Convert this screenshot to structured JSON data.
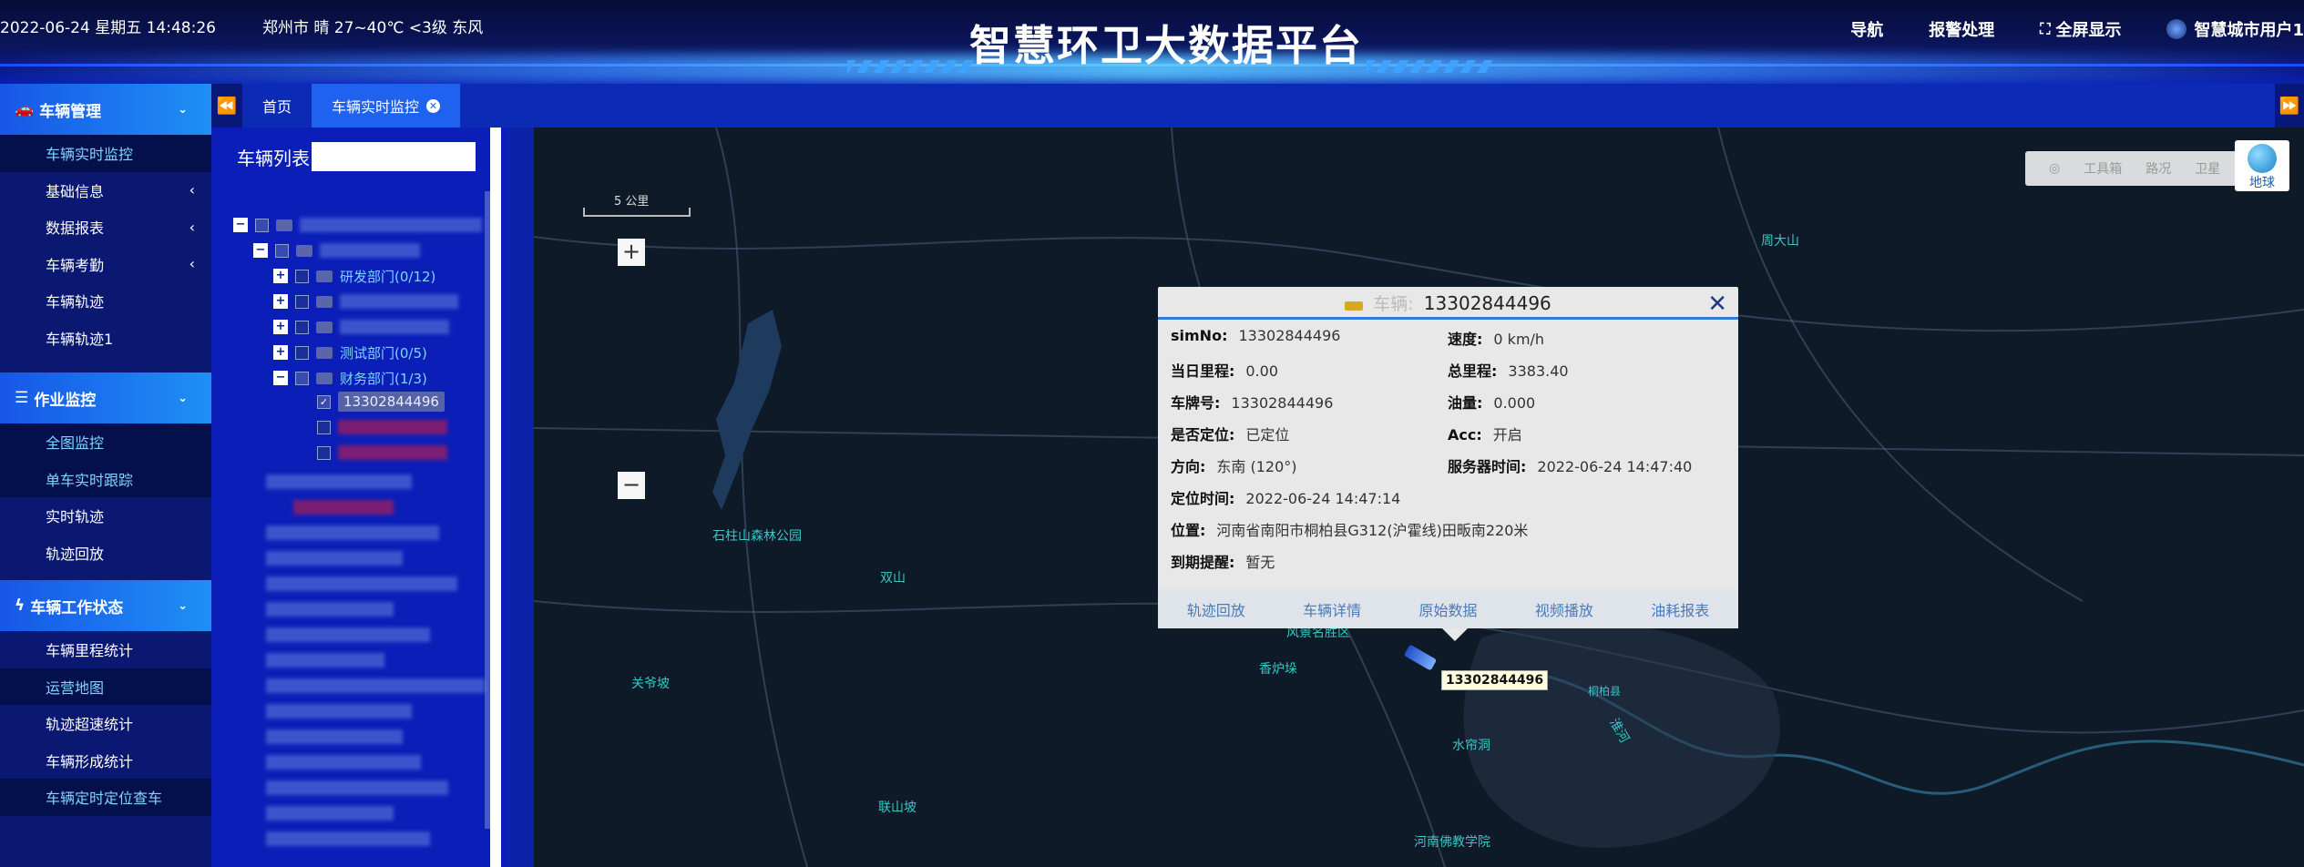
{
  "header": {
    "datetime": "2022-06-24 星期五 14:48:26",
    "weather": "郑州市 晴 27~40℃ <3级 东风",
    "title": "智慧环卫大数据平台",
    "nav": {
      "navigate": "导航",
      "alarm": "报警处理",
      "fullscreen": "全屏显示",
      "user": "智慧城市用户1"
    }
  },
  "sidebar": {
    "sections": [
      {
        "label": "车辆管理",
        "items": [
          "车辆实时监控",
          "基础信息",
          "数据报表",
          "车辆考勤",
          "车辆轨迹",
          "车辆轨迹1"
        ]
      },
      {
        "label": "作业监控",
        "items": [
          "全图监控",
          "单车实时跟踪",
          "实时轨迹",
          "轨迹回放"
        ]
      },
      {
        "label": "车辆工作状态",
        "items": [
          "车辆里程统计",
          "运营地图",
          "轨迹超速统计",
          "车辆形成统计",
          "车辆定时定位查车"
        ]
      }
    ]
  },
  "tabs": {
    "home": "首页",
    "active": "车辆实时监控"
  },
  "tree": {
    "title": "车辆列表",
    "nodes": {
      "dev": "研发部门(0/12)",
      "test": "测试部门(0/5)",
      "finance": "财务部门(1/3)",
      "vehicle": "13302844496"
    }
  },
  "map": {
    "scale": "5 公里",
    "toolbar": {
      "tools": "工具箱",
      "traffic": "路况",
      "satellite": "卫星"
    },
    "earth": "地球",
    "places": {
      "zhoudashan": "周大山",
      "shizhushan": "石柱山森林公园",
      "shuangshan": "双山",
      "guanyinpo": "关爷坡",
      "xianglu": "香炉垛",
      "fengjing": "风景名胜区",
      "shuilian": "水帘洞",
      "lianshan": "联山坡",
      "foxue": "河南佛教学院",
      "tongbai": "桐柏县",
      "huaihe": "淮河"
    }
  },
  "popup": {
    "vehicle_label": "车辆:",
    "vehicle_no": "13302844496",
    "fields": {
      "simno_k": "simNo:",
      "simno_v": "13302844496",
      "speed_k": "速度:",
      "speed_v": "0 km/h",
      "today_k": "当日里程:",
      "today_v": "0.00",
      "total_k": "总里程:",
      "total_v": "3383.40",
      "plate_k": "车牌号:",
      "plate_v": "13302844496",
      "oil_k": "油量:",
      "oil_v": "0.000",
      "located_k": "是否定位:",
      "located_v": "已定位",
      "acc_k": "Acc:",
      "acc_v": "开启",
      "dir_k": "方向:",
      "dir_v": "东南 (120°)",
      "server_k": "服务器时间:",
      "server_v": "2022-06-24 14:47:40",
      "loctime_k": "定位时间:",
      "loctime_v": "2022-06-24 14:47:14",
      "pos_k": "位置:",
      "pos_v": "河南省南阳市桐柏县G312(沪霍线)田畈南220米",
      "expire_k": "到期提醒:",
      "expire_v": "暂无"
    },
    "links": [
      "轨迹回放",
      "车辆详情",
      "原始数据",
      "视频播放",
      "油耗报表"
    ]
  },
  "marker_label": "13302844496",
  "colors": {
    "accent": "#1f8ff5",
    "header_bg": "#0b1660",
    "map_bg": "#0e1a28",
    "place_label": "#35c8c6"
  }
}
